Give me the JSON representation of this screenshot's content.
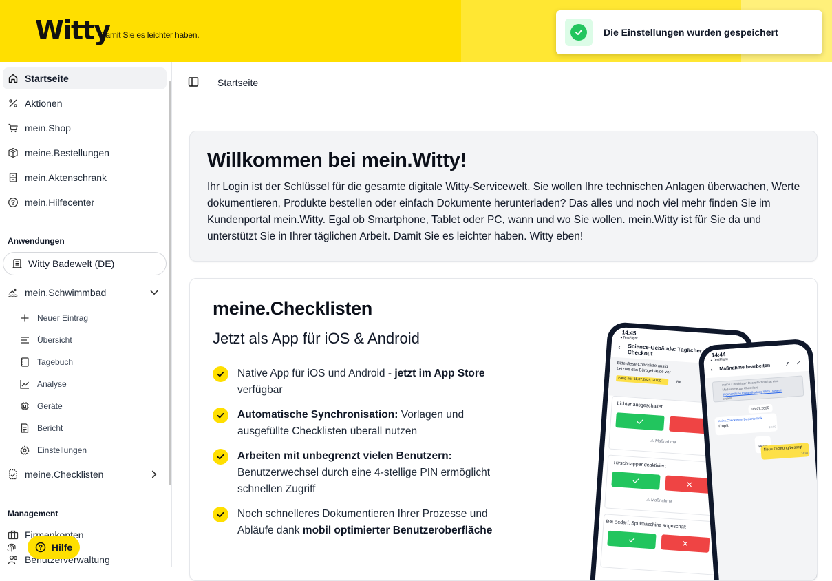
{
  "header": {
    "logo": "Witty",
    "tagline": "Damit Sie es leichter haben.",
    "accent_color": "#ffdf00"
  },
  "toast": {
    "message": "Die Einstellungen wurden gespeichert",
    "icon": "check-circle-icon",
    "status_color": "#22c55e"
  },
  "sidebar": {
    "items": [
      {
        "label": "Startseite",
        "icon": "home-icon",
        "active": true
      },
      {
        "label": "Aktionen",
        "icon": "percent-icon"
      },
      {
        "label": "mein.Shop",
        "icon": "cart-icon"
      },
      {
        "label": "meine.Bestellungen",
        "icon": "package-icon"
      },
      {
        "label": "mein.Aktenschrank",
        "icon": "archive-icon"
      },
      {
        "label": "mein.Hilfecenter",
        "icon": "help-circle-icon"
      }
    ],
    "apps_section_label": "Anwendungen",
    "app_selected": "Witty Badewelt (DE)",
    "schwimmbad": {
      "label": "mein.Schwimmbad",
      "subitems": [
        {
          "label": "Neuer Eintrag",
          "icon": "plus-icon"
        },
        {
          "label": "Übersicht",
          "icon": "list-icon"
        },
        {
          "label": "Tagebuch",
          "icon": "notebook-icon"
        },
        {
          "label": "Analyse",
          "icon": "chart-line-icon"
        },
        {
          "label": "Geräte",
          "icon": "chip-icon"
        },
        {
          "label": "Bericht",
          "icon": "document-icon"
        },
        {
          "label": "Einstellungen",
          "icon": "gear-icon"
        }
      ]
    },
    "checklisten_label": "meine.Checklisten",
    "management_section_label": "Management",
    "management_items": [
      {
        "label": "Firmenkonten",
        "icon": "briefcase-icon"
      },
      {
        "label": "Benutzerverwaltung",
        "icon": "users-icon"
      }
    ],
    "help_button": "Hilfe"
  },
  "main": {
    "breadcrumb": "Startseite",
    "welcome": {
      "title": "Willkommen bei mein.Witty!",
      "text": "Ihr Login ist der Schlüssel für die gesamte digitale Witty-Servicewelt. Sie wollen Ihre technischen Anlagen überwachen, Werte dokumentieren, Produkte bestellen oder einfach Dokumente herunterladen? Das alles und noch viel mehr finden Sie im Kundenportal mein.Witty. Egal ob Smartphone, Tablet oder PC, wann und wo Sie wollen. mein.Witty ist für Sie da und unterstützt Sie in Ihrer täglichen Arbeit. Damit Sie es leichter haben. Witty eben!"
    },
    "checklisten": {
      "title": "meine.Checklisten",
      "subtitle": "Jetzt als App für iOS & Android",
      "features": [
        {
          "pre": "Native App für iOS und Android - ",
          "bold": "jetzt im App Store",
          "post": " verfügbar"
        },
        {
          "pre": "",
          "bold": "Automatische Synchronisation:",
          "post": " Vorlagen und ausgefüllte Checklisten überall nutzen"
        },
        {
          "pre": "",
          "bold": "Arbeiten mit unbegrenzt vielen Benutzern:",
          "post": " Benutzerwechsel durch eine 4-stellige PIN ermöglicht schnellen Zugriff"
        },
        {
          "pre": "Noch schnelleres Dokumentieren Ihrer Prozesse und Abläufe dank ",
          "bold": "mobil optimierter Benutzeroberfläche",
          "post": ""
        }
      ]
    },
    "phone_a": {
      "time": "14:45",
      "carrier": "◂ TestFlight",
      "title": "Science-Gebäude: Täglicher Checkout",
      "intro1": "Bitte diese Checkliste ausfü",
      "intro2": "Letztes das Bürogebäude ver",
      "due": "Fällig bis: 11.07.2025, 20:00",
      "tag": "Re",
      "item1": "Lichter ausgeschaltet",
      "item2": "Türschnapper deaktiviert",
      "item3": "Bei Bedarf: Spülmaschine angeschalt",
      "measure": "Maßnahme"
    },
    "phone_b": {
      "time": "14:44",
      "carrier": "◂ TestFlight",
      "title": "Maßnahme bearbeiten",
      "info1": "meine.Checklisten Dosiertechnik hat eine",
      "info2": "Maßnahme zur Checkliste",
      "info_link": "Wöchentliche Instandhaltung Witty Dosier II",
      "info3": "erstellt.",
      "date": "03.07.2025",
      "msg_sender": "meine.Checklisten Dosiertechnik",
      "msg_text": "Tropft",
      "msg_time": "10:00",
      "today": "Heute",
      "reply": "Neue Dichtung besorgt",
      "reply_time": "14:44"
    }
  }
}
